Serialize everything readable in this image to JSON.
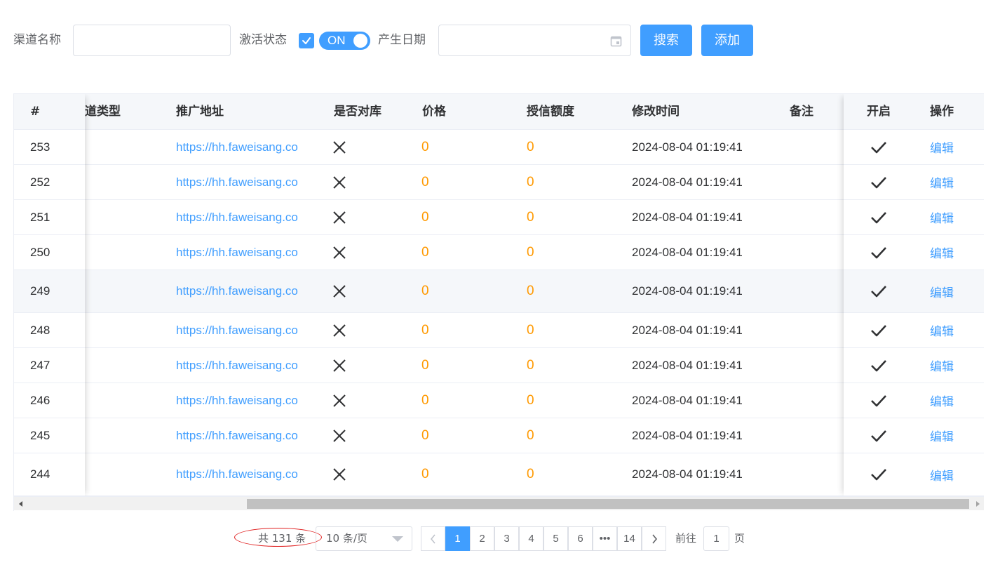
{
  "filters": {
    "channel_name_label": "渠道名称",
    "channel_name_value": "",
    "active_status_label": "激活状态",
    "switch_text": "ON",
    "date_label": "产生日期",
    "date_value": "",
    "search_button": "搜索",
    "add_button": "添加"
  },
  "table": {
    "columns": [
      "#",
      "道类型",
      "推广地址",
      "是否对库",
      "价格",
      "授信额度",
      "修改时间",
      "备注",
      "开启",
      "操作"
    ],
    "rows": [
      {
        "id": "253",
        "url": "https://hh.faweisang.co",
        "price": "0",
        "credit": "0",
        "time": "2024-08-04 01:19:41",
        "action": "编辑"
      },
      {
        "id": "252",
        "url": "https://hh.faweisang.co",
        "price": "0",
        "credit": "0",
        "time": "2024-08-04 01:19:41",
        "action": "编辑"
      },
      {
        "id": "251",
        "url": "https://hh.faweisang.co",
        "price": "0",
        "credit": "0",
        "time": "2024-08-04 01:19:41",
        "action": "编辑"
      },
      {
        "id": "250",
        "url": "https://hh.faweisang.co",
        "price": "0",
        "credit": "0",
        "time": "2024-08-04 01:19:41",
        "action": "编辑"
      },
      {
        "id": "249",
        "url": "https://hh.faweisang.co",
        "price": "0",
        "credit": "0",
        "time": "2024-08-04 01:19:41",
        "action": "编辑"
      },
      {
        "id": "248",
        "url": "https://hh.faweisang.co",
        "price": "0",
        "credit": "0",
        "time": "2024-08-04 01:19:41",
        "action": "编辑"
      },
      {
        "id": "247",
        "url": "https://hh.faweisang.co",
        "price": "0",
        "credit": "0",
        "time": "2024-08-04 01:19:41",
        "action": "编辑"
      },
      {
        "id": "246",
        "url": "https://hh.faweisang.co",
        "price": "0",
        "credit": "0",
        "time": "2024-08-04 01:19:41",
        "action": "编辑"
      },
      {
        "id": "245",
        "url": "https://hh.faweisang.co",
        "price": "0",
        "credit": "0",
        "time": "2024-08-04 01:19:41",
        "action": "编辑"
      },
      {
        "id": "244",
        "url": "https://hh.faweisang.co",
        "price": "0",
        "credit": "0",
        "time": "2024-08-04 01:19:41",
        "action": "编辑"
      }
    ]
  },
  "pagination": {
    "total": "共 131 条",
    "page_size": "10 条/页",
    "pages": [
      "1",
      "2",
      "3",
      "4",
      "5",
      "6",
      "•••",
      "14"
    ],
    "current": "1",
    "goto_prefix": "前往",
    "goto_value": "1",
    "goto_suffix": "页"
  },
  "colors": {
    "primary": "#409eff",
    "number": "#ff9900",
    "annotation": "#e02020"
  }
}
